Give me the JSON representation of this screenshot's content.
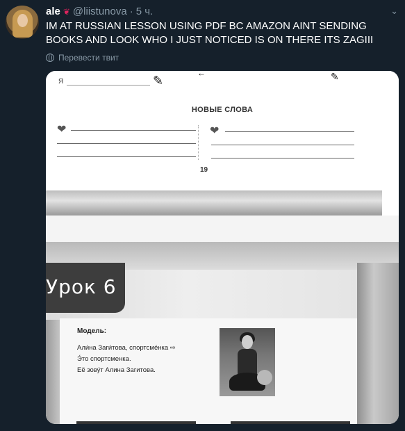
{
  "tweet": {
    "display_name": "ale",
    "name_icon": "rose-icon",
    "handle": "@liistunova",
    "separator": "·",
    "time": "5 ч.",
    "text": "IM AT RUSSIAN LESSON USING PDF BC AMAZON AINT SENDING BOOKS AND LOOK WHO I JUST NOTICED IS ON THERE ITS ZAGIII",
    "translate_label": "Перевести твит"
  },
  "image": {
    "top_page": {
      "ya": "Я",
      "heading": "НОВЫЕ СЛОВА",
      "page_number": "19"
    },
    "lesson": {
      "title": "Урок 6",
      "model_label": "Модель:",
      "line1": "Али́на Заги́това, спортсме́нка ⇨",
      "line2": "Э́то спортсменка.",
      "line3": "Её зову́т Алина Загитова."
    }
  },
  "colors": {
    "background": "#15202b",
    "secondary_text": "#8899a6",
    "primary_text": "#ffffff"
  }
}
